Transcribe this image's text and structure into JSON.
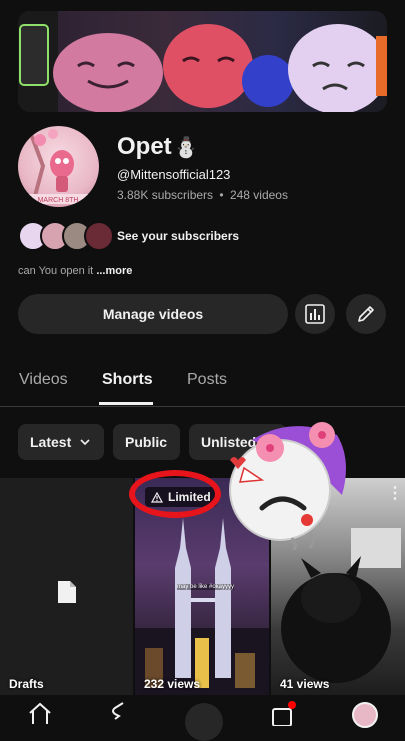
{
  "channel": {
    "name": "Opet",
    "name_emoji": "⛄",
    "handle": "@Mittensofficial123",
    "subscribers": "3.88K subscribers",
    "separator": "•",
    "videos": "248 videos",
    "see_subscribers": "See your subscribers",
    "description": "can You open it",
    "more_link": "...more",
    "avatar_lettering": "MARCH 8TH"
  },
  "actions": {
    "manage_videos": "Manage videos",
    "analytics_icon": "bar-chart-icon",
    "edit_icon": "pencil-icon"
  },
  "tabs": [
    {
      "label": "Videos",
      "active": false
    },
    {
      "label": "Shorts",
      "active": true
    },
    {
      "label": "Posts",
      "active": false
    }
  ],
  "filters": {
    "latest": "Latest",
    "public": "Public",
    "unlisted": "Unlisted"
  },
  "grid": {
    "drafts_label": "Drafts",
    "limited_label": "Limited",
    "short1_views": "232 views",
    "short1_caption": "may be like #okayyyy",
    "short2_views": "41 views"
  },
  "colors": {
    "background": "#0f0f0f",
    "surface": "#272727",
    "annotation_red": "#e8141c",
    "notification_dot": "#ff0000"
  }
}
